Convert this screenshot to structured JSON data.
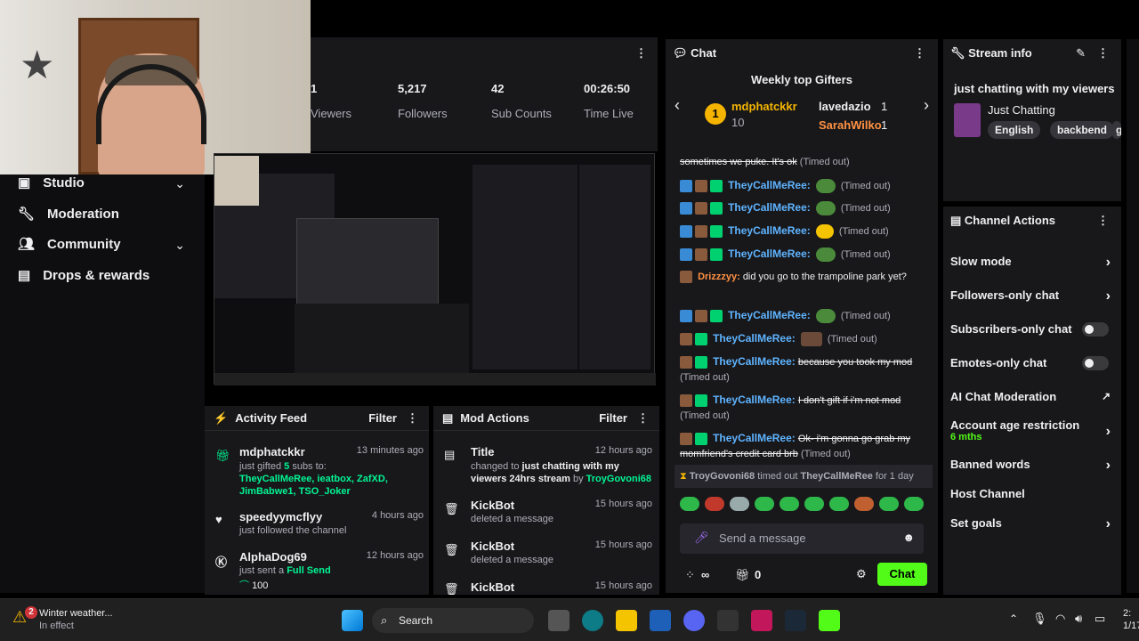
{
  "stats": {
    "viewers_value": "1",
    "viewers_label": "Viewers",
    "followers_value": "5,217",
    "followers_label": "Followers",
    "subs_value": "42",
    "subs_label": "Sub Counts",
    "time_value": "00:26:50",
    "time_label": "Time Live"
  },
  "sidebar": {
    "items": [
      {
        "label": "Studio",
        "icon": "studio-icon"
      },
      {
        "label": "Moderation",
        "icon": "wrench-icon"
      },
      {
        "label": "Community",
        "icon": "community-icon"
      },
      {
        "label": "Drops & rewards",
        "icon": "drops-icon"
      }
    ]
  },
  "activity_feed": {
    "title": "Activity Feed",
    "filter": "Filter",
    "items": [
      {
        "user": "mdphatckkr",
        "time": "13 minutes ago",
        "text_prefix": "just gifted ",
        "count": "5",
        "text_suffix": " subs to:",
        "recipients": "TheyCallMeRee, ieatbox, ZafXD, JimBabwe1, TSO_Joker"
      },
      {
        "user": "speedyymcflyy",
        "time": "4 hours ago",
        "text": "just followed the channel"
      },
      {
        "user": "AlphaDog69",
        "time": "12 hours ago",
        "text_prefix": "just sent a ",
        "highlight": "Full Send",
        "amount": "100"
      }
    ]
  },
  "mod_actions": {
    "title": "Mod Actions",
    "filter": "Filter",
    "items": [
      {
        "user": "Title",
        "time": "12 hours ago",
        "text_prefix": "changed to ",
        "bold_text": "just chatting with my viewers 24hrs stream",
        "by": " by ",
        "by_user": "TroyGovoni68"
      },
      {
        "user": "KickBot",
        "time": "15 hours ago",
        "text": "deleted a message"
      },
      {
        "user": "KickBot",
        "time": "15 hours ago",
        "text": "deleted a message"
      },
      {
        "user": "KickBot",
        "time": "15 hours ago"
      }
    ]
  },
  "chat": {
    "title": "Chat",
    "gifters_title": "Weekly top Gifters",
    "gifter1": {
      "name": "mdphatckkr",
      "count": "10",
      "rank": "1"
    },
    "gifter2": {
      "name": "lavedazio",
      "count": "1"
    },
    "gifter3": {
      "name": "SarahWilko",
      "count": "1"
    },
    "messages": [
      {
        "user": "",
        "text": "sometimes we puke. It's ok",
        "suffix": "(Timed out)"
      },
      {
        "user": "TheyCallMeRee:",
        "suffix": "(Timed out)"
      },
      {
        "user": "TheyCallMeRee:",
        "suffix": "(Timed out)"
      },
      {
        "user": "TheyCallMeRee:",
        "suffix": "(Timed out)"
      },
      {
        "user": "TheyCallMeRee:",
        "suffix": "(Timed out)"
      },
      {
        "user": "Drizzzyy:",
        "text": "did you go to the trampoline park yet?"
      },
      {
        "user": "TheyCallMeRee:",
        "suffix": "(Timed out)"
      },
      {
        "user": "TheyCallMeRee:",
        "suffix": "(Timed out)"
      },
      {
        "user": "TheyCallMeRee:",
        "text": "because you took my mod",
        "suffix": "(Timed out)"
      },
      {
        "user": "TheyCallMeRee:",
        "text": "I don't gift if i'm not mod",
        "suffix": "(Timed out)"
      },
      {
        "user": "TheyCallMeRee:",
        "text": "Ok- i'm gonna go grab my momfriend's credit card brb",
        "suffix": "(Timed out)"
      }
    ],
    "timeout_notice": {
      "mod": "TroyGovoni68",
      "action": "timed out",
      "target": "TheyCallMeRee",
      "duration": "for 1 day"
    },
    "input_placeholder": "Send a message",
    "points": "∞",
    "gift_count": "0",
    "send_label": "Chat"
  },
  "stream_info": {
    "title": "Stream info",
    "stream_title": "just chatting with my viewers",
    "category": "Just Chatting",
    "tags": [
      "English",
      "backbend",
      "g"
    ]
  },
  "channel_actions": {
    "title": "Channel Actions",
    "items": [
      {
        "label": "Slow mode",
        "control": "chevron"
      },
      {
        "label": "Followers-only chat",
        "control": "chevron"
      },
      {
        "label": "Subscribers-only chat",
        "control": "toggle"
      },
      {
        "label": "Emotes-only chat",
        "control": "toggle"
      },
      {
        "label": "AI Chat Moderation",
        "control": "external"
      },
      {
        "label": "Account age restriction",
        "sub": "6 mths",
        "control": "chevron"
      },
      {
        "label": "Banned words",
        "control": "chevron"
      },
      {
        "label": "Host Channel",
        "control": "none"
      },
      {
        "label": "Set goals",
        "control": "chevron"
      }
    ]
  },
  "taskbar": {
    "weather_title": "Winter weather...",
    "weather_sub": "In effect",
    "weather_badge": "2",
    "search_label": "Search",
    "clock_time": "2:",
    "clock_date": "1/17"
  },
  "colors": {
    "accent": "#53fc18",
    "panel": "#18181b",
    "background": "#0e0e10"
  }
}
